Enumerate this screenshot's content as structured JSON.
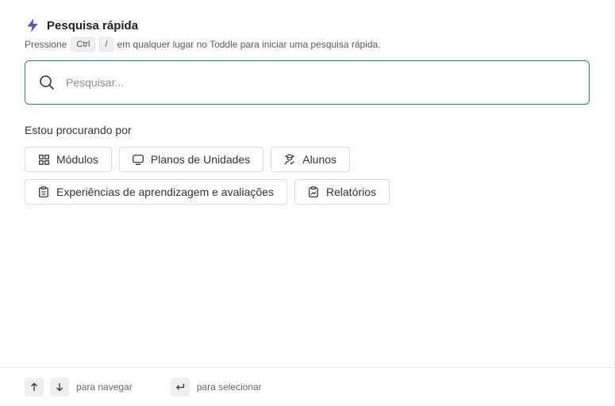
{
  "header": {
    "title": "Pesquisa rápida",
    "subtitle_before": "Pressione",
    "key_ctrl": "Ctrl",
    "key_slash": "/",
    "subtitle_after": "em qualquer lugar no Toddle para iniciar uma pesquisa rápida.",
    "accent_color": "#5b4fd6"
  },
  "search": {
    "placeholder": "Pesquisar...",
    "value": "",
    "border_color": "#1a8a85"
  },
  "filters": {
    "label": "Estou procurando por",
    "chips": [
      {
        "label": "Módulos",
        "icon": "grid-icon"
      },
      {
        "label": "Planos de Unidades",
        "icon": "board-icon"
      },
      {
        "label": "Alunos",
        "icon": "student-icon"
      },
      {
        "label": "Experiências de aprendizagem e avaliações",
        "icon": "clipboard-icon"
      },
      {
        "label": "Relatórios",
        "icon": "report-icon"
      }
    ]
  },
  "footer": {
    "navigate_label": "para navegar",
    "select_label": "para selecionar"
  }
}
